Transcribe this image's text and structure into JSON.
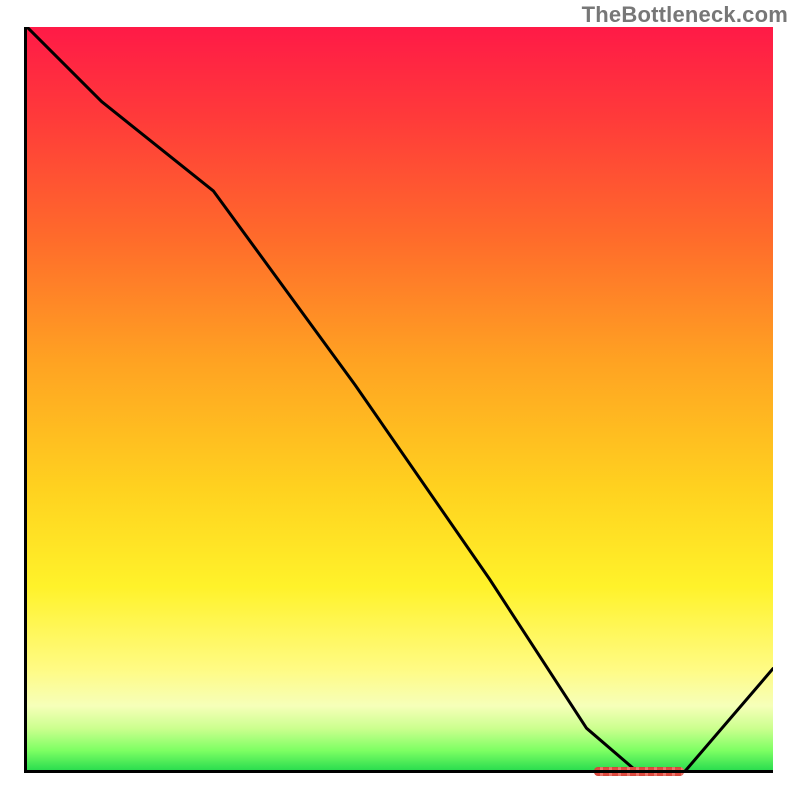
{
  "watermark": "TheBottleneck.com",
  "chart_data": {
    "type": "line",
    "title": "",
    "xlabel": "",
    "ylabel": "",
    "xlim": [
      0,
      100
    ],
    "ylim": [
      0,
      100
    ],
    "grid": false,
    "series": [
      {
        "name": "curve",
        "x": [
          0,
          10,
          25,
          44,
          62,
          75,
          82,
          88,
          100
        ],
        "y": [
          100,
          90,
          78,
          52,
          26,
          6,
          0,
          0,
          14
        ]
      }
    ],
    "marker": {
      "x_start": 76,
      "x_end": 88,
      "y": 0
    },
    "background_gradient": {
      "top": "#ff1a47",
      "mid": "#ffd21f",
      "bottom": "#1fd84c"
    }
  }
}
